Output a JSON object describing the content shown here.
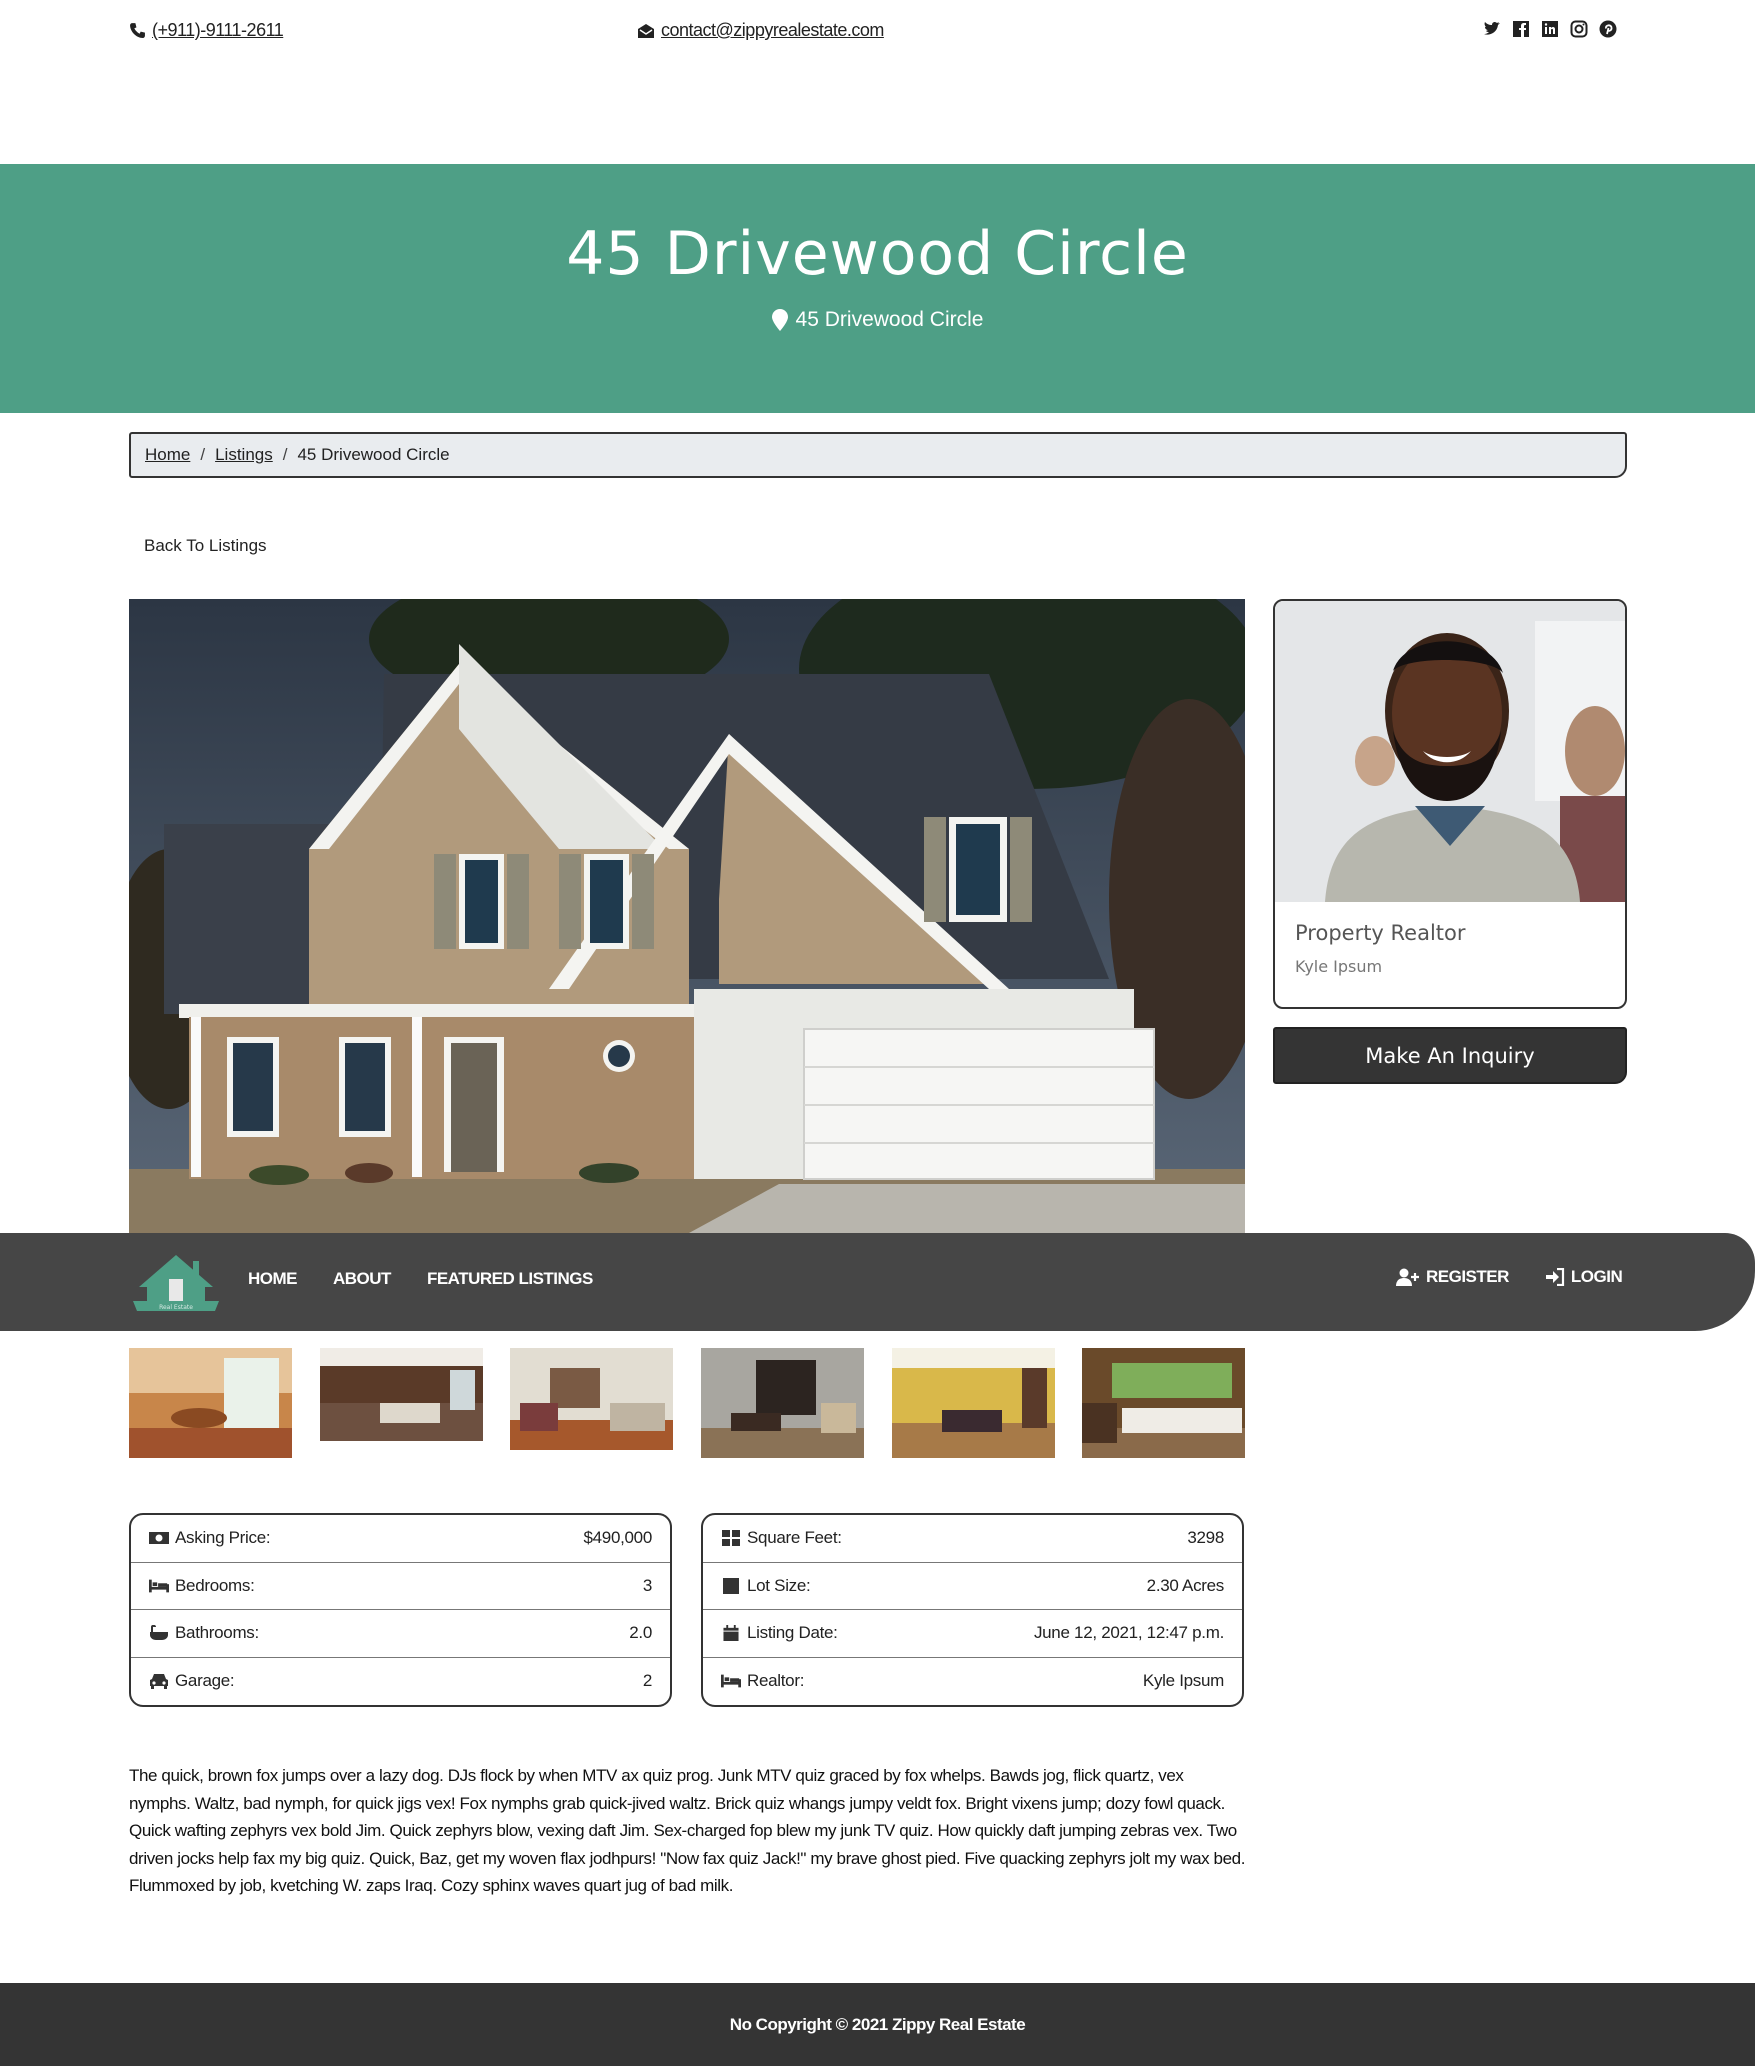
{
  "topbar": {
    "phone": "(+911)-9111-2611",
    "email": "contact@zippyrealestate.com",
    "social_icons": [
      "twitter-icon",
      "facebook-icon",
      "linkedin-icon",
      "instagram-icon",
      "pinterest-icon"
    ]
  },
  "hero": {
    "title": "45 Drivewood Circle",
    "address": "45 Drivewood Circle",
    "color": "#4e9f86"
  },
  "breadcrumb": {
    "home": "Home",
    "listings": "Listings",
    "current": "45 Drivewood Circle",
    "separator": "/"
  },
  "back_link": "Back To Listings",
  "navbar": {
    "logo_text": "Real Estate",
    "links": [
      "HOME",
      "ABOUT",
      "FEATURED LISTINGS"
    ],
    "register": "REGISTER",
    "login": "LOGIN"
  },
  "realtor": {
    "title": "Property Realtor",
    "name": "Kyle Ipsum",
    "inquiry_button": "Make An Inquiry"
  },
  "details_left": [
    {
      "label": "Asking Price:",
      "value": "$490,000",
      "icon": "money-icon"
    },
    {
      "label": "Bedrooms:",
      "value": "3",
      "icon": "bed-icon"
    },
    {
      "label": "Bathrooms:",
      "value": "2.0",
      "icon": "bath-icon"
    },
    {
      "label": "Garage:",
      "value": "2",
      "icon": "car-icon"
    }
  ],
  "details_right": [
    {
      "label": "Square Feet:",
      "value": "3298",
      "icon": "grid-icon"
    },
    {
      "label": "Lot Size:",
      "value": "2.30 Acres",
      "icon": "square-icon"
    },
    {
      "label": "Listing Date:",
      "value": "June 12, 2021, 12:47 p.m.",
      "icon": "calendar-icon"
    },
    {
      "label": "Realtor:",
      "value": "Kyle Ipsum",
      "icon": "bed-icon"
    }
  ],
  "description": "The quick, brown fox jumps over a lazy dog. DJs flock by when MTV ax quiz prog. Junk MTV quiz graced by fox whelps. Bawds jog, flick quartz, vex nymphs. Waltz, bad nymph, for quick jigs vex! Fox nymphs grab quick-jived waltz. Brick quiz whangs jumpy veldt fox. Bright vixens jump; dozy fowl quack. Quick wafting zephyrs vex bold Jim. Quick zephyrs blow, vexing daft Jim. Sex-charged fop blew my junk TV quiz. How quickly daft jumping zebras vex. Two driven jocks help fax my big quiz. Quick, Baz, get my woven flax jodhpurs! \"Now fax quiz Jack!\" my brave ghost pied. Five quacking zephyrs jolt my wax bed. Flummoxed by job, kvetching W. zaps Iraq. Cozy sphinx waves quart jug of bad milk.",
  "footer": "No Copyright © 2021 Zippy Real Estate"
}
